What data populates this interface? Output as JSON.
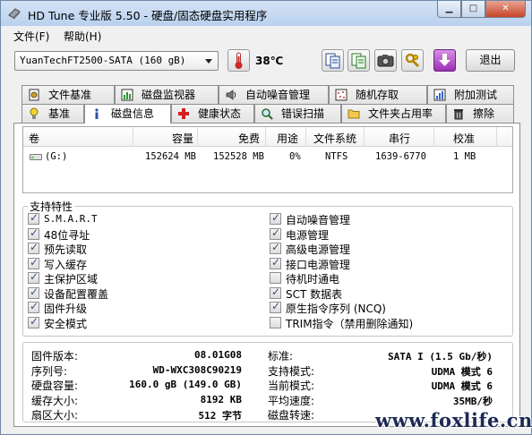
{
  "window": {
    "title": "HD Tune 专业版 5.50 - 硬盘/固态硬盘实用程序"
  },
  "menu": {
    "file": "文件(F)",
    "help": "帮助(H)"
  },
  "toolbar": {
    "drive_selected": "YuanTechFT2500-SATA (160 gB)",
    "temperature": "38℃",
    "exit_label": "退出"
  },
  "tabs_top": [
    {
      "label": "文件基准",
      "icon": "file-benchmark-icon"
    },
    {
      "label": "磁盘监视器",
      "icon": "disk-monitor-icon"
    },
    {
      "label": "自动噪音管理",
      "icon": "speaker-icon"
    },
    {
      "label": "随机存取",
      "icon": "random-access-icon"
    },
    {
      "label": "附加测试",
      "icon": "extra-tests-icon"
    }
  ],
  "tabs_bottom": [
    {
      "label": "基准",
      "icon": "benchmark-icon"
    },
    {
      "label": "磁盘信息",
      "icon": "info-icon"
    },
    {
      "label": "健康状态",
      "icon": "health-cross-icon"
    },
    {
      "label": "错误扫描",
      "icon": "magnifier-icon"
    },
    {
      "label": "文件夹占用率",
      "icon": "folder-icon"
    },
    {
      "label": "擦除",
      "icon": "trash-icon"
    }
  ],
  "volumes": {
    "headers": {
      "volume": "卷",
      "capacity": "容量",
      "free": "免费",
      "usage": "用途",
      "filesystem": "文件系统",
      "serial": "串行",
      "calibration": "校准"
    },
    "rows": [
      {
        "volume": "(G:)",
        "capacity": "152624 MB",
        "free": "152528 MB",
        "usage": "0%",
        "filesystem": "NTFS",
        "serial": "1639-6770",
        "calibration": "1 MB"
      }
    ]
  },
  "features": {
    "title": "支持特性",
    "left": [
      {
        "label": "S.M.A.R.T",
        "checked": true
      },
      {
        "label": "48位寻址",
        "checked": true
      },
      {
        "label": "预先读取",
        "checked": true
      },
      {
        "label": "写入缓存",
        "checked": true
      },
      {
        "label": "主保护区域",
        "checked": true
      },
      {
        "label": "设备配置覆盖",
        "checked": true
      },
      {
        "label": "固件升级",
        "checked": true
      },
      {
        "label": "安全模式",
        "checked": true
      }
    ],
    "right": [
      {
        "label": "自动噪音管理",
        "checked": true
      },
      {
        "label": "电源管理",
        "checked": true
      },
      {
        "label": "高级电源管理",
        "checked": true
      },
      {
        "label": "接口电源管理",
        "checked": true
      },
      {
        "label": "待机时通电",
        "checked": false
      },
      {
        "label": "SCT 数据表",
        "checked": true
      },
      {
        "label": "原生指令序列 (NCQ)",
        "checked": true
      },
      {
        "label": "TRIM指令（禁用删除通知)",
        "checked": false
      }
    ]
  },
  "info": {
    "left": [
      {
        "label": "固件版本:",
        "value": "08.01G08"
      },
      {
        "label": "序列号:",
        "value": "WD-WXC308C90219"
      },
      {
        "label": "硬盘容量:",
        "value": "160.0 gB (149.0 GB)"
      },
      {
        "label": "缓存大小:",
        "value": "8192 KB"
      },
      {
        "label": "扇区大小:",
        "value": "512 字节"
      }
    ],
    "right": [
      {
        "label": "标准:",
        "value": "SATA I (1.5 Gb/秒)"
      },
      {
        "label": "支持模式:",
        "value": "UDMA 模式 6"
      },
      {
        "label": "当前模式:",
        "value": "UDMA 模式 6"
      },
      {
        "label": "平均速度:",
        "value": "35MB/秒"
      },
      {
        "label": "磁盘转速:",
        "value": ""
      }
    ]
  },
  "watermark": "www.foxlife.cn"
}
